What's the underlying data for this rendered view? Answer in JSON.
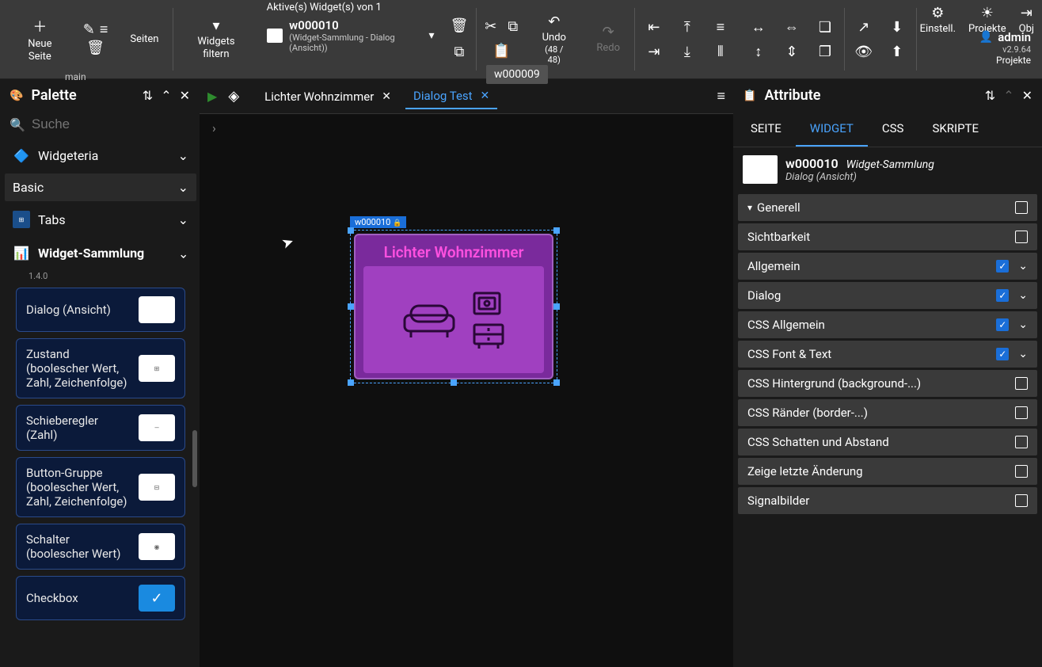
{
  "toolbar": {
    "new_page": "Neue Seite",
    "pages": "Seiten",
    "filter_widgets": "Widgets filtern",
    "active_widgets_header": "Aktive(s) Widget(s) von 1",
    "selected_widget_id": "w000010",
    "selected_widget_sub": "(Widget-Sammlung - Dialog (Ansicht))",
    "undo": "Undo",
    "undo_count": "(48 / 48)",
    "redo": "Redo",
    "settings": "Einstell.",
    "projects": "Projekte",
    "obj": "Obj",
    "user": "admin",
    "version": "v2.9.64",
    "projects_link": "Projekte",
    "main_label": "main",
    "hover_tooltip": "w000009"
  },
  "palette": {
    "title": "Palette",
    "search_placeholder": "Suche",
    "groups": [
      {
        "title": "Widgeteria",
        "expanded": false,
        "icon": "widgeteria"
      },
      {
        "title": "Basic",
        "expanded": false,
        "icon": ""
      },
      {
        "title": "Tabs",
        "expanded": false,
        "icon": "tabs"
      },
      {
        "title": "Widget-Sammlung",
        "expanded": true,
        "icon": "sammlung"
      }
    ],
    "sammlung_version": "1.4.0",
    "items": [
      {
        "label": "Dialog (Ansicht)"
      },
      {
        "label": "Zustand (boolescher Wert, Zahl, Zeichenfolge)"
      },
      {
        "label": "Schieberegler (Zahl)"
      },
      {
        "label": "Button-Gruppe (boolescher Wert, Zahl, Zeichenfolge)"
      },
      {
        "label": "Schalter (boolescher Wert)"
      },
      {
        "label": "Checkbox"
      }
    ]
  },
  "canvas": {
    "tabs": [
      {
        "label": "Lichter Wohnzimmer",
        "active": false
      },
      {
        "label": "Dialog Test",
        "active": true
      }
    ],
    "widget_badge": "w000010",
    "widget_title": "Lichter Wohnzimmer"
  },
  "attributes": {
    "title": "Attribute",
    "tabs": [
      {
        "label": "SEITE",
        "active": false
      },
      {
        "label": "WIDGET",
        "active": true
      },
      {
        "label": "CSS",
        "active": false
      },
      {
        "label": "SKRIPTE",
        "active": false
      }
    ],
    "widget_id": "w000010",
    "widget_type": "Widget-Sammlung",
    "widget_sub": "Dialog (Ansicht)",
    "sections": [
      {
        "title": "Generell",
        "checked": false,
        "chevron": false,
        "filter_icon": true
      },
      {
        "title": "Sichtbarkeit",
        "checked": false,
        "chevron": false
      },
      {
        "title": "Allgemein",
        "checked": true,
        "chevron": true
      },
      {
        "title": "Dialog",
        "checked": true,
        "chevron": true
      },
      {
        "title": "CSS Allgemein",
        "checked": true,
        "chevron": true
      },
      {
        "title": "CSS Font & Text",
        "checked": true,
        "chevron": true
      },
      {
        "title": "CSS Hintergrund (background-...)",
        "checked": false,
        "chevron": false
      },
      {
        "title": "CSS Ränder (border-...)",
        "checked": false,
        "chevron": false
      },
      {
        "title": "CSS Schatten und Abstand",
        "checked": false,
        "chevron": false
      },
      {
        "title": "Zeige letzte Änderung",
        "checked": false,
        "chevron": false
      },
      {
        "title": "Signalbilder",
        "checked": false,
        "chevron": false
      }
    ]
  }
}
